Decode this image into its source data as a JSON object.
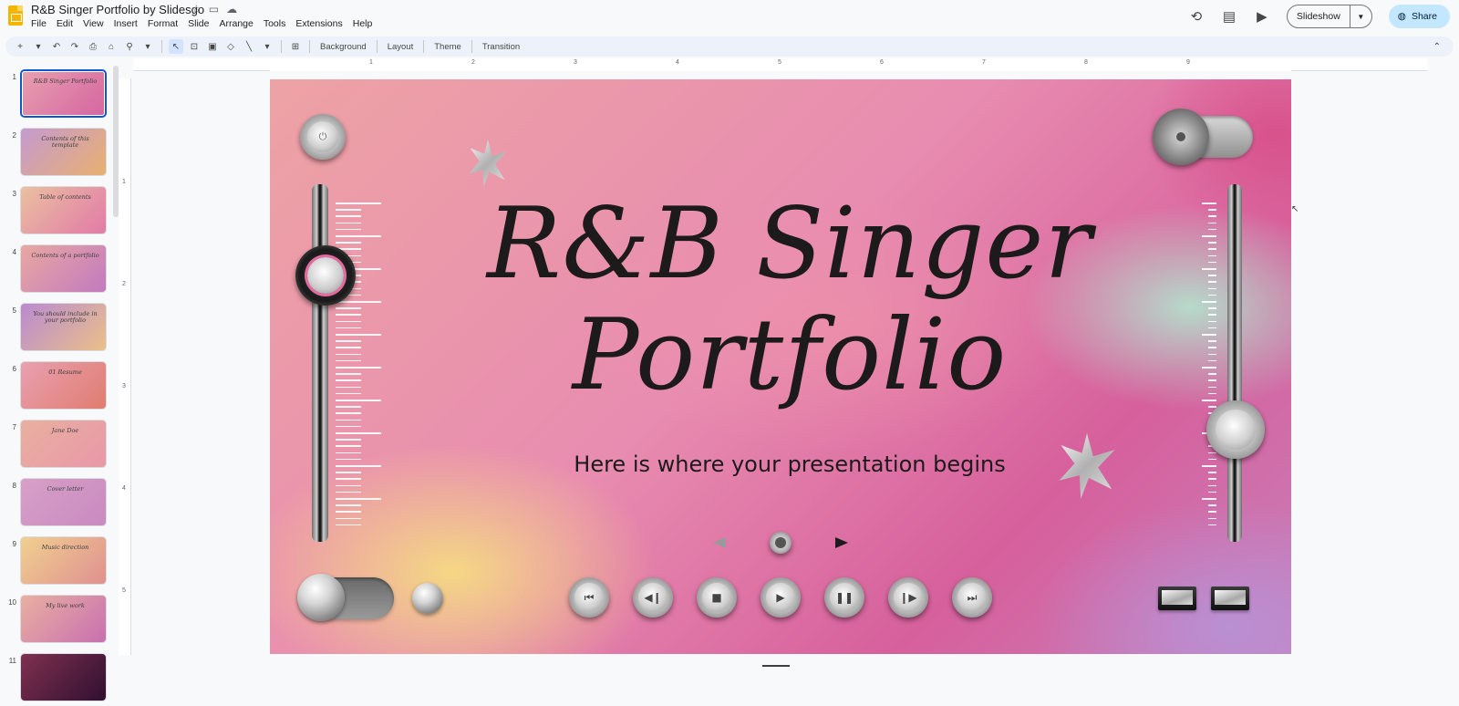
{
  "app": {
    "doc_title": "R&B Singer Portfolio by Slidesgo",
    "menu": [
      "File",
      "Edit",
      "View",
      "Insert",
      "Format",
      "Slide",
      "Arrange",
      "Tools",
      "Extensions",
      "Help"
    ],
    "slideshow_label": "Slideshow",
    "share_label": "Share"
  },
  "toolbar": {
    "background_label": "Background",
    "layout_label": "Layout",
    "theme_label": "Theme",
    "transition_label": "Transition"
  },
  "filmstrip": {
    "slides": [
      {
        "num": "1",
        "label": "R&B Singer Portfolio",
        "colors": [
          "#e8a0b0",
          "#d565a0"
        ]
      },
      {
        "num": "2",
        "label": "Contents of this template",
        "colors": [
          "#c59ad0",
          "#e8b070"
        ]
      },
      {
        "num": "3",
        "label": "Table of contents",
        "colors": [
          "#eac0a0",
          "#e27aa8"
        ]
      },
      {
        "num": "4",
        "label": "Contents of a portfolio",
        "colors": [
          "#e8a8a0",
          "#c37ac0"
        ]
      },
      {
        "num": "5",
        "label": "You should include in your portfolio",
        "colors": [
          "#b98ad0",
          "#eac08a"
        ]
      },
      {
        "num": "6",
        "label": "01 Resume",
        "colors": [
          "#e8a0b0",
          "#e17c70"
        ]
      },
      {
        "num": "7",
        "label": "Jane Doe",
        "colors": [
          "#e8b0a0",
          "#e898a8"
        ]
      },
      {
        "num": "8",
        "label": "Cover letter",
        "colors": [
          "#d7a0c8",
          "#c98ac0"
        ]
      },
      {
        "num": "9",
        "label": "Music direction",
        "colors": [
          "#f0d090",
          "#e09090"
        ]
      },
      {
        "num": "10",
        "label": "My live work",
        "colors": [
          "#e8b0a0",
          "#c870b0"
        ]
      },
      {
        "num": "11",
        "label": "",
        "colors": [
          "#803050",
          "#301030"
        ]
      }
    ]
  },
  "ruler": {
    "h_numbers": [
      "1",
      "2",
      "3",
      "4",
      "5",
      "6",
      "7",
      "8",
      "9"
    ],
    "v_numbers": [
      "1",
      "2",
      "3",
      "4",
      "5"
    ]
  },
  "slide": {
    "title_line1": "R&B Singer",
    "title_line2": "Portfolio",
    "subtitle": "Here is where your presentation begins",
    "transport_buttons": [
      "skip-back",
      "rewind",
      "stop",
      "play",
      "pause",
      "forward",
      "skip-forward"
    ]
  }
}
